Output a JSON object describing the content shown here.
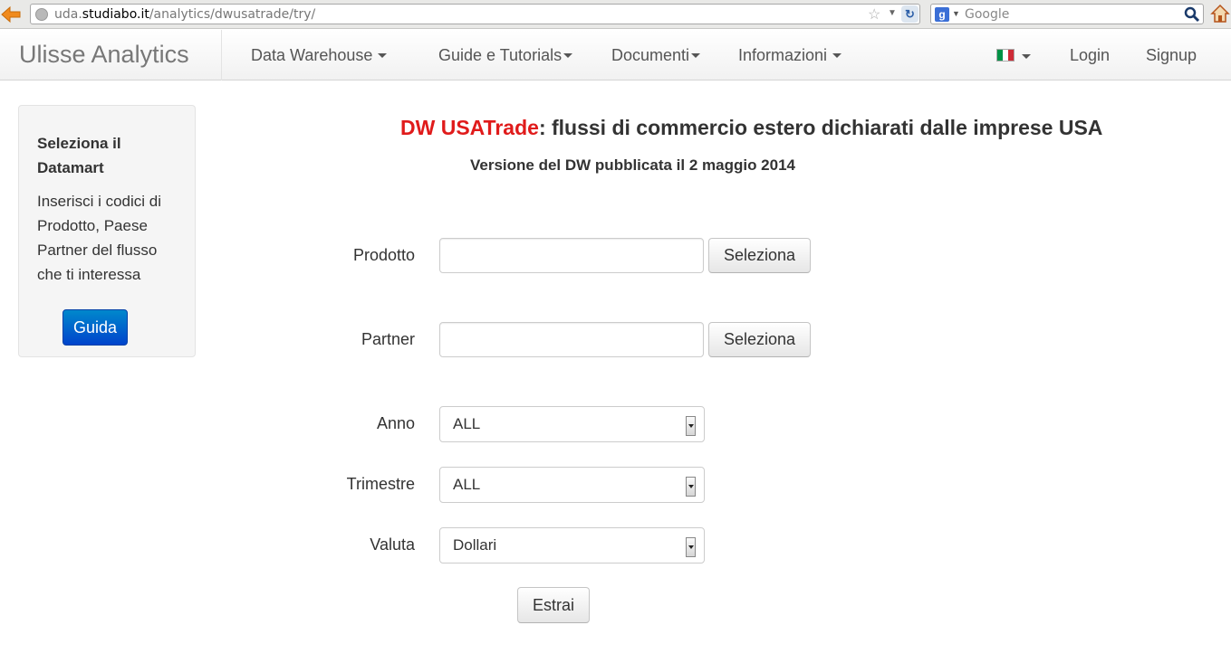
{
  "browser": {
    "url_domain_prefix": "uda.",
    "url_domain": "studiabo.it",
    "url_path": "/analytics/dwusatrade/try/",
    "search_placeholder": "Google",
    "search_engine_letter": "g"
  },
  "navbar": {
    "brand": "Ulisse Analytics",
    "items": [
      {
        "label": "Data Warehouse"
      },
      {
        "label": "Guide e Tutorials"
      },
      {
        "label": "Documenti"
      },
      {
        "label": "Informazioni"
      }
    ],
    "language_flag": "italy-flag-icon",
    "login": "Login",
    "signup": "Signup"
  },
  "sidebar": {
    "title": "Seleziona il Datamart",
    "text": "Inserisci i codici di Prodotto, Paese Partner del flusso che ti interessa",
    "button": "Guida"
  },
  "main": {
    "title_highlight": "DW USATrade",
    "title_rest": ": flussi di commercio estero dichiarati dalle imprese USA",
    "subtitle": "Versione del DW pubblicata il 2 maggio 2014"
  },
  "form": {
    "prodotto": {
      "label": "Prodotto",
      "value": "",
      "button": "Seleziona"
    },
    "partner": {
      "label": "Partner",
      "value": "",
      "button": "Seleziona"
    },
    "anno": {
      "label": "Anno",
      "selected": "ALL"
    },
    "trimestre": {
      "label": "Trimestre",
      "selected": "ALL"
    },
    "valuta": {
      "label": "Valuta",
      "selected": "Dollari"
    },
    "submit": "Estrai"
  },
  "colors": {
    "accent_red": "#e01b1b",
    "primary_blue": "#0055cc"
  }
}
